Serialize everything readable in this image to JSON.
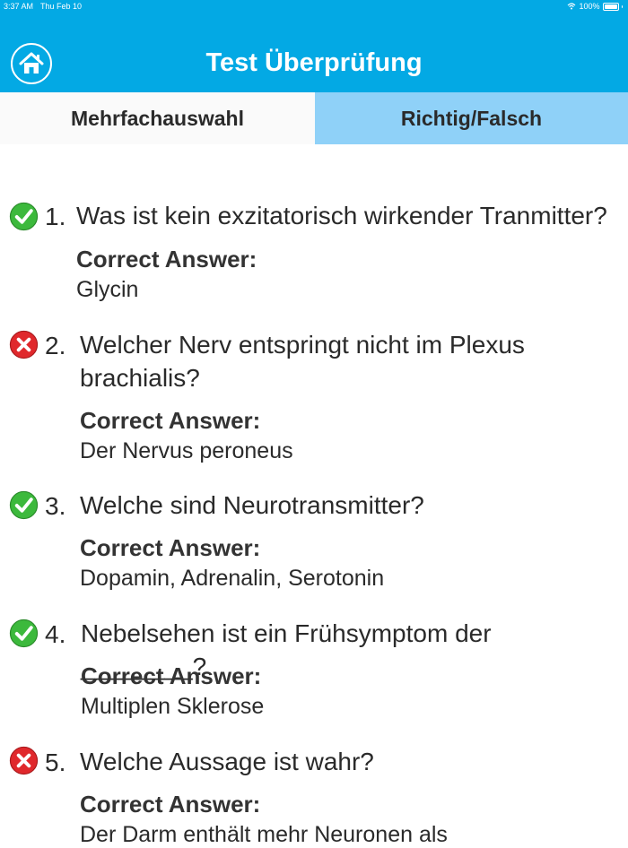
{
  "status": {
    "time": "3:37 AM",
    "date": "Thu Feb 10",
    "battery": "100%"
  },
  "header": {
    "title": "Test Überprüfung",
    "home_icon": "home-icon"
  },
  "tabs": [
    {
      "label": "Mehrfachauswahl",
      "selected": true
    },
    {
      "label": "Richtig/Falsch",
      "selected": false
    }
  ],
  "questions": [
    {
      "number": "1.",
      "text": "Was ist kein exzitatorisch wirkender Tranmitter?",
      "correct_label": "Correct Answer:",
      "answer": "Glycin",
      "result": "correct"
    },
    {
      "number": "2.",
      "text": "Welcher Nerv entspringt nicht im Plexus brachialis?",
      "correct_label": "Correct Answer:",
      "answer": "Der Nervus peroneus",
      "result": "wrong"
    },
    {
      "number": "3.",
      "text": "Welche sind Neurotransmitter?",
      "correct_label": "Correct Answer:",
      "answer": "Dopamin, Adrenalin, Serotonin",
      "result": "correct"
    },
    {
      "number": "4.",
      "text": "Nebelsehen ist ein Frühsymptom der ________?",
      "correct_label": "Correct Answer:",
      "answer": "Multiplen Sklerose",
      "result": "correct"
    },
    {
      "number": "5.",
      "text": "Welche Aussage ist wahr?",
      "correct_label": "Correct Answer:",
      "answer": "Der Darm enthält mehr Neuronen als",
      "result": "wrong"
    }
  ],
  "colors": {
    "header": "#03a9e4",
    "tab_selected": "#fafafa",
    "tab_unselected": "#8fd1f8",
    "correct": "#3cb93c",
    "wrong": "#e0282c"
  }
}
